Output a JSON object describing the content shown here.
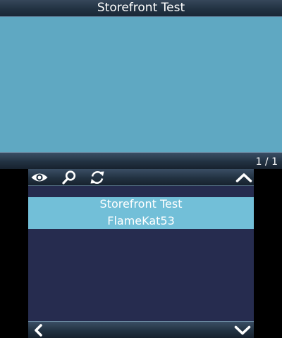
{
  "top_screen": {
    "title": "Storefront Test",
    "page_indicator": "1 / 1",
    "background_color": "#5fa8c2"
  },
  "toolbar": {
    "icons": [
      "eye-icon",
      "search-icon",
      "refresh-icon",
      "chevron-up-icon"
    ]
  },
  "list": {
    "items": [
      {
        "title": "Storefront Test",
        "author": "FlameKat53",
        "selected": true
      }
    ],
    "highlight_color": "#72bfd8",
    "background_color": "#262c4f"
  },
  "bottom_bar": {
    "icons": [
      "chevron-left-icon",
      "chevron-down-icon"
    ]
  }
}
